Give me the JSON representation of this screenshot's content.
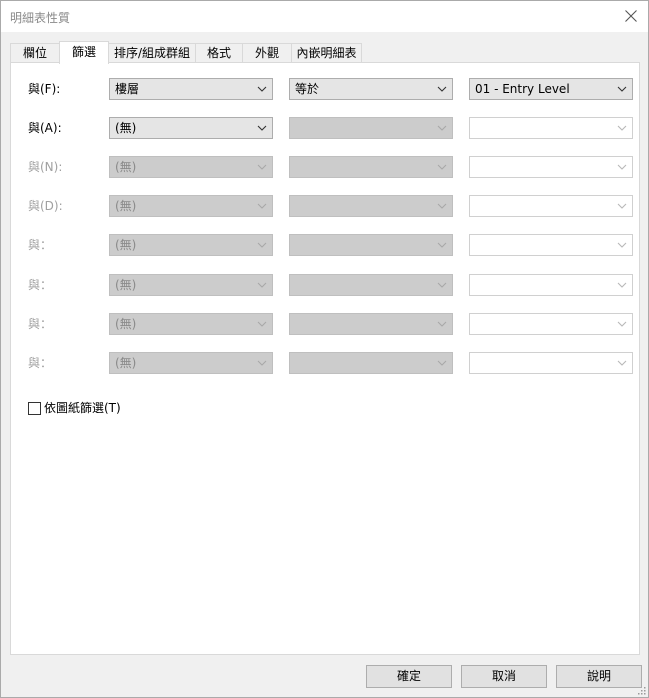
{
  "window": {
    "title": "明細表性質"
  },
  "tabs": [
    {
      "label": "欄位"
    },
    {
      "label": "篩選"
    },
    {
      "label": "排序/組成群組"
    },
    {
      "label": "格式"
    },
    {
      "label": "外觀"
    },
    {
      "label": "內嵌明細表"
    }
  ],
  "filters": [
    {
      "label": "與(F):",
      "field": "樓層",
      "operator": "等於",
      "value": "01 - Entry Level"
    },
    {
      "label": "與(A):",
      "field": "(無)",
      "operator": "",
      "value": ""
    },
    {
      "label": "與(N):",
      "field": "(無)",
      "operator": "",
      "value": ""
    },
    {
      "label": "與(D):",
      "field": "(無)",
      "operator": "",
      "value": ""
    },
    {
      "label": "與：",
      "field": "(無)",
      "operator": "",
      "value": ""
    },
    {
      "label": "與：",
      "field": "(無)",
      "operator": "",
      "value": ""
    },
    {
      "label": "與：",
      "field": "(無)",
      "operator": "",
      "value": ""
    },
    {
      "label": "與：",
      "field": "(無)",
      "operator": "",
      "value": ""
    }
  ],
  "sheet_filter": {
    "label": "依圖紙篩選(T)",
    "checked": false
  },
  "buttons": {
    "ok": "確定",
    "cancel": "取消",
    "help": "說明"
  }
}
